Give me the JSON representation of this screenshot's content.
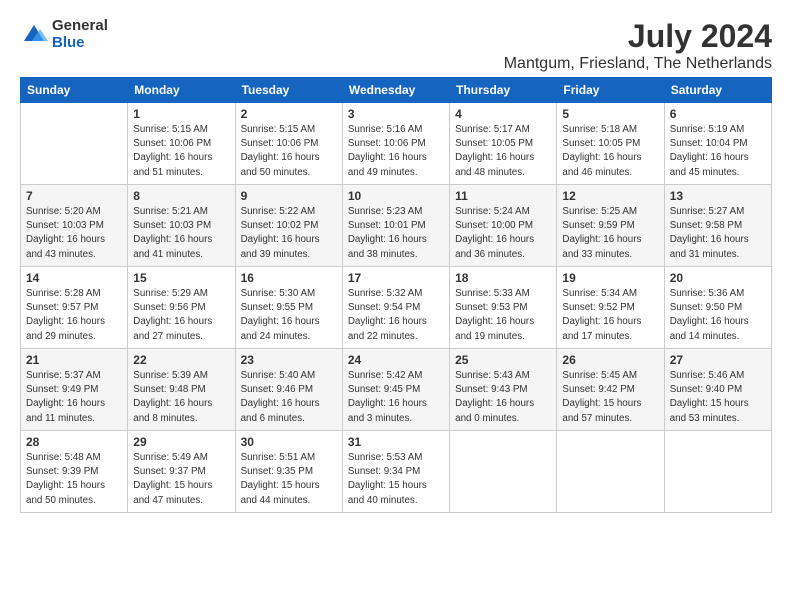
{
  "logo": {
    "general": "General",
    "blue": "Blue"
  },
  "title": "July 2024",
  "subtitle": "Mantgum, Friesland, The Netherlands",
  "headers": [
    "Sunday",
    "Monday",
    "Tuesday",
    "Wednesday",
    "Thursday",
    "Friday",
    "Saturday"
  ],
  "weeks": [
    [
      {
        "day": "",
        "info": ""
      },
      {
        "day": "1",
        "info": "Sunrise: 5:15 AM\nSunset: 10:06 PM\nDaylight: 16 hours\nand 51 minutes."
      },
      {
        "day": "2",
        "info": "Sunrise: 5:15 AM\nSunset: 10:06 PM\nDaylight: 16 hours\nand 50 minutes."
      },
      {
        "day": "3",
        "info": "Sunrise: 5:16 AM\nSunset: 10:06 PM\nDaylight: 16 hours\nand 49 minutes."
      },
      {
        "day": "4",
        "info": "Sunrise: 5:17 AM\nSunset: 10:05 PM\nDaylight: 16 hours\nand 48 minutes."
      },
      {
        "day": "5",
        "info": "Sunrise: 5:18 AM\nSunset: 10:05 PM\nDaylight: 16 hours\nand 46 minutes."
      },
      {
        "day": "6",
        "info": "Sunrise: 5:19 AM\nSunset: 10:04 PM\nDaylight: 16 hours\nand 45 minutes."
      }
    ],
    [
      {
        "day": "7",
        "info": "Sunrise: 5:20 AM\nSunset: 10:03 PM\nDaylight: 16 hours\nand 43 minutes."
      },
      {
        "day": "8",
        "info": "Sunrise: 5:21 AM\nSunset: 10:03 PM\nDaylight: 16 hours\nand 41 minutes."
      },
      {
        "day": "9",
        "info": "Sunrise: 5:22 AM\nSunset: 10:02 PM\nDaylight: 16 hours\nand 39 minutes."
      },
      {
        "day": "10",
        "info": "Sunrise: 5:23 AM\nSunset: 10:01 PM\nDaylight: 16 hours\nand 38 minutes."
      },
      {
        "day": "11",
        "info": "Sunrise: 5:24 AM\nSunset: 10:00 PM\nDaylight: 16 hours\nand 36 minutes."
      },
      {
        "day": "12",
        "info": "Sunrise: 5:25 AM\nSunset: 9:59 PM\nDaylight: 16 hours\nand 33 minutes."
      },
      {
        "day": "13",
        "info": "Sunrise: 5:27 AM\nSunset: 9:58 PM\nDaylight: 16 hours\nand 31 minutes."
      }
    ],
    [
      {
        "day": "14",
        "info": "Sunrise: 5:28 AM\nSunset: 9:57 PM\nDaylight: 16 hours\nand 29 minutes."
      },
      {
        "day": "15",
        "info": "Sunrise: 5:29 AM\nSunset: 9:56 PM\nDaylight: 16 hours\nand 27 minutes."
      },
      {
        "day": "16",
        "info": "Sunrise: 5:30 AM\nSunset: 9:55 PM\nDaylight: 16 hours\nand 24 minutes."
      },
      {
        "day": "17",
        "info": "Sunrise: 5:32 AM\nSunset: 9:54 PM\nDaylight: 16 hours\nand 22 minutes."
      },
      {
        "day": "18",
        "info": "Sunrise: 5:33 AM\nSunset: 9:53 PM\nDaylight: 16 hours\nand 19 minutes."
      },
      {
        "day": "19",
        "info": "Sunrise: 5:34 AM\nSunset: 9:52 PM\nDaylight: 16 hours\nand 17 minutes."
      },
      {
        "day": "20",
        "info": "Sunrise: 5:36 AM\nSunset: 9:50 PM\nDaylight: 16 hours\nand 14 minutes."
      }
    ],
    [
      {
        "day": "21",
        "info": "Sunrise: 5:37 AM\nSunset: 9:49 PM\nDaylight: 16 hours\nand 11 minutes."
      },
      {
        "day": "22",
        "info": "Sunrise: 5:39 AM\nSunset: 9:48 PM\nDaylight: 16 hours\nand 8 minutes."
      },
      {
        "day": "23",
        "info": "Sunrise: 5:40 AM\nSunset: 9:46 PM\nDaylight: 16 hours\nand 6 minutes."
      },
      {
        "day": "24",
        "info": "Sunrise: 5:42 AM\nSunset: 9:45 PM\nDaylight: 16 hours\nand 3 minutes."
      },
      {
        "day": "25",
        "info": "Sunrise: 5:43 AM\nSunset: 9:43 PM\nDaylight: 16 hours\nand 0 minutes."
      },
      {
        "day": "26",
        "info": "Sunrise: 5:45 AM\nSunset: 9:42 PM\nDaylight: 15 hours\nand 57 minutes."
      },
      {
        "day": "27",
        "info": "Sunrise: 5:46 AM\nSunset: 9:40 PM\nDaylight: 15 hours\nand 53 minutes."
      }
    ],
    [
      {
        "day": "28",
        "info": "Sunrise: 5:48 AM\nSunset: 9:39 PM\nDaylight: 15 hours\nand 50 minutes."
      },
      {
        "day": "29",
        "info": "Sunrise: 5:49 AM\nSunset: 9:37 PM\nDaylight: 15 hours\nand 47 minutes."
      },
      {
        "day": "30",
        "info": "Sunrise: 5:51 AM\nSunset: 9:35 PM\nDaylight: 15 hours\nand 44 minutes."
      },
      {
        "day": "31",
        "info": "Sunrise: 5:53 AM\nSunset: 9:34 PM\nDaylight: 15 hours\nand 40 minutes."
      },
      {
        "day": "",
        "info": ""
      },
      {
        "day": "",
        "info": ""
      },
      {
        "day": "",
        "info": ""
      }
    ]
  ]
}
